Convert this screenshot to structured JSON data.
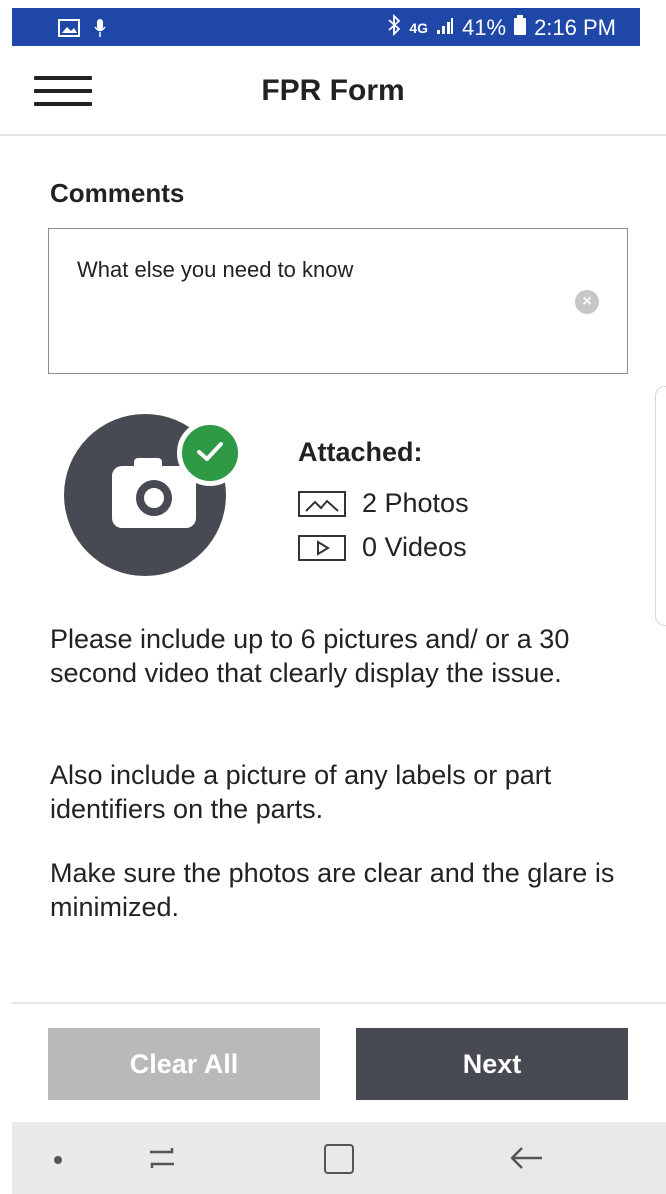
{
  "status_bar": {
    "network": "4G",
    "battery": "41%",
    "time": "2:16 PM",
    "icons": [
      "gallery-icon",
      "microphone-icon",
      "bluetooth-icon",
      "signal-icon",
      "battery-icon"
    ]
  },
  "app_bar": {
    "title": "FPR Form",
    "menu_icon": "hamburger-menu-icon"
  },
  "comments": {
    "label": "Comments",
    "value": "What else you need to know",
    "clear_icon": "clear-input-icon"
  },
  "attachments": {
    "label": "Attached:",
    "photos": "2 Photos",
    "videos": "0 Videos",
    "photos_icon": "image-icon",
    "videos_icon": "video-icon",
    "camera_icon": "camera-icon",
    "check_icon": "check-icon",
    "check_color": "#2e9a46",
    "camera_color": "#474a52"
  },
  "instructions": [
    "Please include up to 6 pictures and/ or a 30 second video that clearly display the issue.",
    "Also include a picture of any labels or part identifiers on the parts.",
    "Make sure the photos are clear and the glare is minimized."
  ],
  "actions": {
    "clear_all": "Clear All",
    "next": "Next",
    "clear_color": "#b9b9b9",
    "next_color": "#474a52"
  },
  "colors": {
    "status_bar": "#1f47a8",
    "nav_bar": "#e9e9ec"
  },
  "nav_bar": {
    "icons": [
      "nav-dot-icon",
      "recent-apps-icon",
      "home-icon",
      "back-icon"
    ]
  }
}
